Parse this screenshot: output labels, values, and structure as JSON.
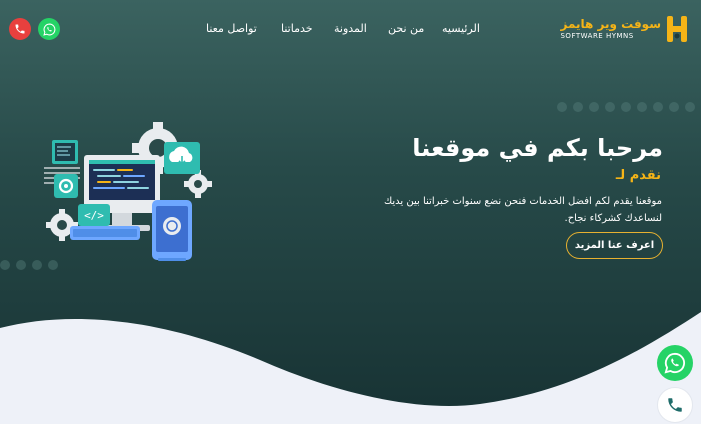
{
  "brand": {
    "name_ar": "سوفت وير هايمز",
    "name_en": "SOFTWARE HYMNS",
    "accent": "#f5b417"
  },
  "nav": {
    "items": [
      {
        "label": "الرئيسيه"
      },
      {
        "label": "من نحن"
      },
      {
        "label": "المدونة"
      },
      {
        "label": "خدماتنا"
      },
      {
        "label": "تواصل معنا"
      }
    ]
  },
  "contact_icons": {
    "whatsapp": {
      "icon": "whatsapp-icon",
      "color": "#25d366"
    },
    "phone": {
      "icon": "phone-icon",
      "color": "#e8403e"
    }
  },
  "hero": {
    "title": "مرحبا بكم في موقعنا",
    "subtitle": "نقدم لـ",
    "description": "موقعنا يقدم لكم افضل الخدمات فنحن نضع سنوات خبراتنا بين يديك لنساعدك كشركاء نجاح.",
    "cta_label": "اعرف عنا المزيد",
    "illustration": "computer-devices-illustration"
  },
  "floating": {
    "whatsapp_icon": "whatsapp-icon",
    "phone_icon": "phone-icon"
  }
}
